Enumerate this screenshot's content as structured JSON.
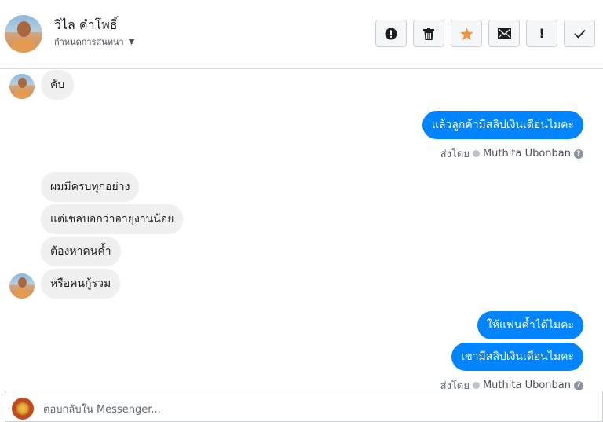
{
  "header": {
    "contact_name": "วิไล คำโพธิ์",
    "subtitle": "กำหนดการสนทนา",
    "toolbar": [
      {
        "name": "spam-button",
        "icon": "alert-circle-icon"
      },
      {
        "name": "delete-button",
        "icon": "trash-icon"
      },
      {
        "name": "star-button",
        "icon": "star-icon"
      },
      {
        "name": "mark-unread-button",
        "icon": "envelope-icon"
      },
      {
        "name": "follow-up-button",
        "icon": "exclamation-icon"
      },
      {
        "name": "mark-done-button",
        "icon": "check-icon"
      }
    ]
  },
  "messages": [
    {
      "direction": "in",
      "text": "คับ"
    },
    {
      "direction": "out",
      "text": "แล้วลูกค้ามีสลิปเงินเดือนไมคะ"
    },
    {
      "direction": "in",
      "text": "ผมมีครบทุกอย่าง"
    },
    {
      "direction": "in",
      "text": "แต่เชลบอกว่าอายุงานน้อย"
    },
    {
      "direction": "in",
      "text": "ต้องหาคนค้ำ"
    },
    {
      "direction": "in",
      "text": "หรือคนกู้รวม"
    },
    {
      "direction": "out",
      "text": "ให้แฟนค้ำได้ไมคะ"
    },
    {
      "direction": "out",
      "text": "เขามีสลิปเงินเดือนไมคะ"
    }
  ],
  "sent_by": {
    "prefix": "ส่งโดย",
    "agent": "Muthita Ubonban",
    "help": "?"
  },
  "composer": {
    "placeholder": "ตอบกลับใน Messenger..."
  },
  "colors": {
    "outgoing_bubble": "#0084ff",
    "incoming_bubble": "#f1f0f0",
    "star": "#f7923a"
  }
}
